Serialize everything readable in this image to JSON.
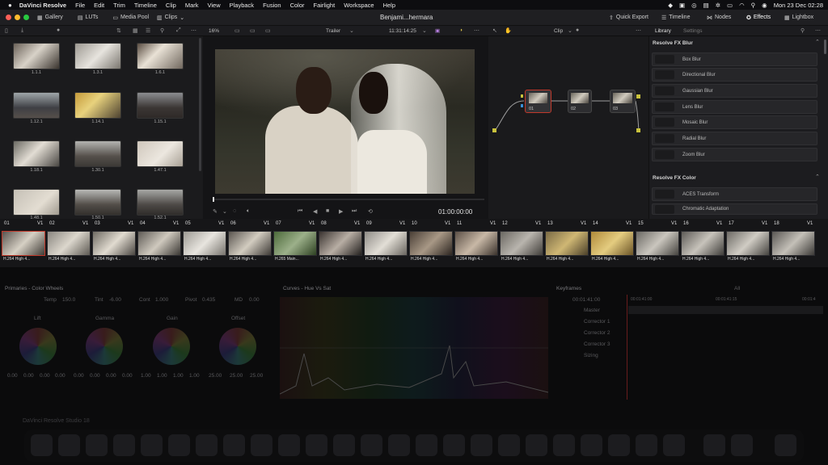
{
  "menubar": {
    "apple": "",
    "app_name": "DaVinci Resolve",
    "items": [
      "File",
      "Edit",
      "Trim",
      "Timeline",
      "Clip",
      "Mark",
      "View",
      "Playback",
      "Fusion",
      "Color",
      "Fairlight",
      "Workspace",
      "Help"
    ],
    "clock": "Mon 23 Dec  02:28"
  },
  "toolbar": {
    "gallery": "Gallery",
    "luts": "LUTs",
    "media_pool": "Media Pool",
    "clips": "Clips",
    "project_title": "Benjami...hermara",
    "quick_export": "Quick Export",
    "timeline": "Timeline",
    "nodes": "Nodes",
    "effects": "Effects",
    "lightbox": "Lightbox"
  },
  "subbar": {
    "zoom": "16%",
    "timeline_name": "Trailer",
    "timecode": "11:31:14:25",
    "clip_mode": "Clip",
    "library_tab": "Library",
    "settings_tab": "Settings"
  },
  "gallery": {
    "stills": [
      "1.1.1",
      "1.3.1",
      "1.6.1",
      "1.12.1",
      "1.14.1",
      "1.15.1",
      "1.18.1",
      "1.30.1",
      "1.47.1",
      "1.48.1",
      "1.50.1",
      "1.52.1"
    ]
  },
  "viewer": {
    "timecode": "01:00:00:00"
  },
  "nodes": {
    "items": [
      "01",
      "02",
      "03"
    ]
  },
  "library": {
    "blur_header": "Resolve FX Blur",
    "blur_items": [
      "Box Blur",
      "Directional Blur",
      "Gaussian Blur",
      "Lens Blur",
      "Mosaic Blur",
      "Radial Blur",
      "Zoom Blur"
    ],
    "color_header": "Resolve FX Color",
    "color_items": [
      "ACES Transform",
      "Chromatic Adaptation"
    ]
  },
  "timeline": {
    "clips": [
      {
        "num": "01",
        "track": "V1",
        "label": "H.264 High 4..."
      },
      {
        "num": "02",
        "track": "V1",
        "label": "H.264 High 4..."
      },
      {
        "num": "03",
        "track": "V1",
        "label": "H.264 High 4..."
      },
      {
        "num": "04",
        "track": "V1",
        "label": "H.264 High 4..."
      },
      {
        "num": "05",
        "track": "V1",
        "label": "H.264 High 4..."
      },
      {
        "num": "06",
        "track": "V1",
        "label": "H.264 High 4..."
      },
      {
        "num": "07",
        "track": "V1",
        "label": "H.265 Main..."
      },
      {
        "num": "08",
        "track": "V1",
        "label": "H.264 High 4..."
      },
      {
        "num": "09",
        "track": "V1",
        "label": "H.264 High 4..."
      },
      {
        "num": "10",
        "track": "V1",
        "label": "H.264 High 4..."
      },
      {
        "num": "11",
        "track": "V1",
        "label": "H.264 High 4..."
      },
      {
        "num": "12",
        "track": "V1",
        "label": "H.264 High 4..."
      },
      {
        "num": "13",
        "track": "V1",
        "label": "H.264 High 4..."
      },
      {
        "num": "14",
        "track": "V1",
        "label": "H.264 High 4..."
      },
      {
        "num": "15",
        "track": "V1",
        "label": "H.264 High 4..."
      },
      {
        "num": "16",
        "track": "V1",
        "label": "H.264 High 4..."
      },
      {
        "num": "17",
        "track": "V1",
        "label": "H.264 High 4..."
      },
      {
        "num": "18",
        "track": "V1",
        "label": "H.264 High 4..."
      }
    ]
  },
  "color": {
    "primaries_title": "Primaries - Color Wheels",
    "temp_label": "Temp",
    "temp": "150.0",
    "tint_label": "Tint",
    "tint": "-6.00",
    "cont_label": "Cont",
    "cont": "1.000",
    "pivot_label": "Pivot",
    "pivot": "0.435",
    "md_label": "MD",
    "md": "0.00",
    "wheels": [
      "Lift",
      "Gamma",
      "Gain",
      "Offset"
    ],
    "lift_vals": [
      "0.00",
      "0.00",
      "0.00",
      "0.00"
    ],
    "gamma_vals": [
      "0.00",
      "0.00",
      "0.00",
      "0.00"
    ],
    "gain_vals": [
      "1.00",
      "1.00",
      "1.00",
      "1.00"
    ],
    "offset_vals": [
      "25.00",
      "25.00",
      "25.00"
    ],
    "curves_title": "Curves - Hue Vs Sat",
    "keyframes_title": "Keyframes",
    "keyframes_filter": "All",
    "kf_timecode": "00:01:41:00",
    "kf_ruler": [
      "00:01:41:00",
      "00:01:41:15",
      "00:01:4"
    ],
    "kf_tracks": [
      "Master",
      "Corrector 1",
      "Corrector 2",
      "Corrector 3",
      "Sizing"
    ],
    "status": "DaVinci Resolve Studio 18"
  },
  "colors": {
    "accent_red": "#c0392b",
    "selected_blue": "#4a90d9",
    "effects_active": "#ffffff"
  }
}
